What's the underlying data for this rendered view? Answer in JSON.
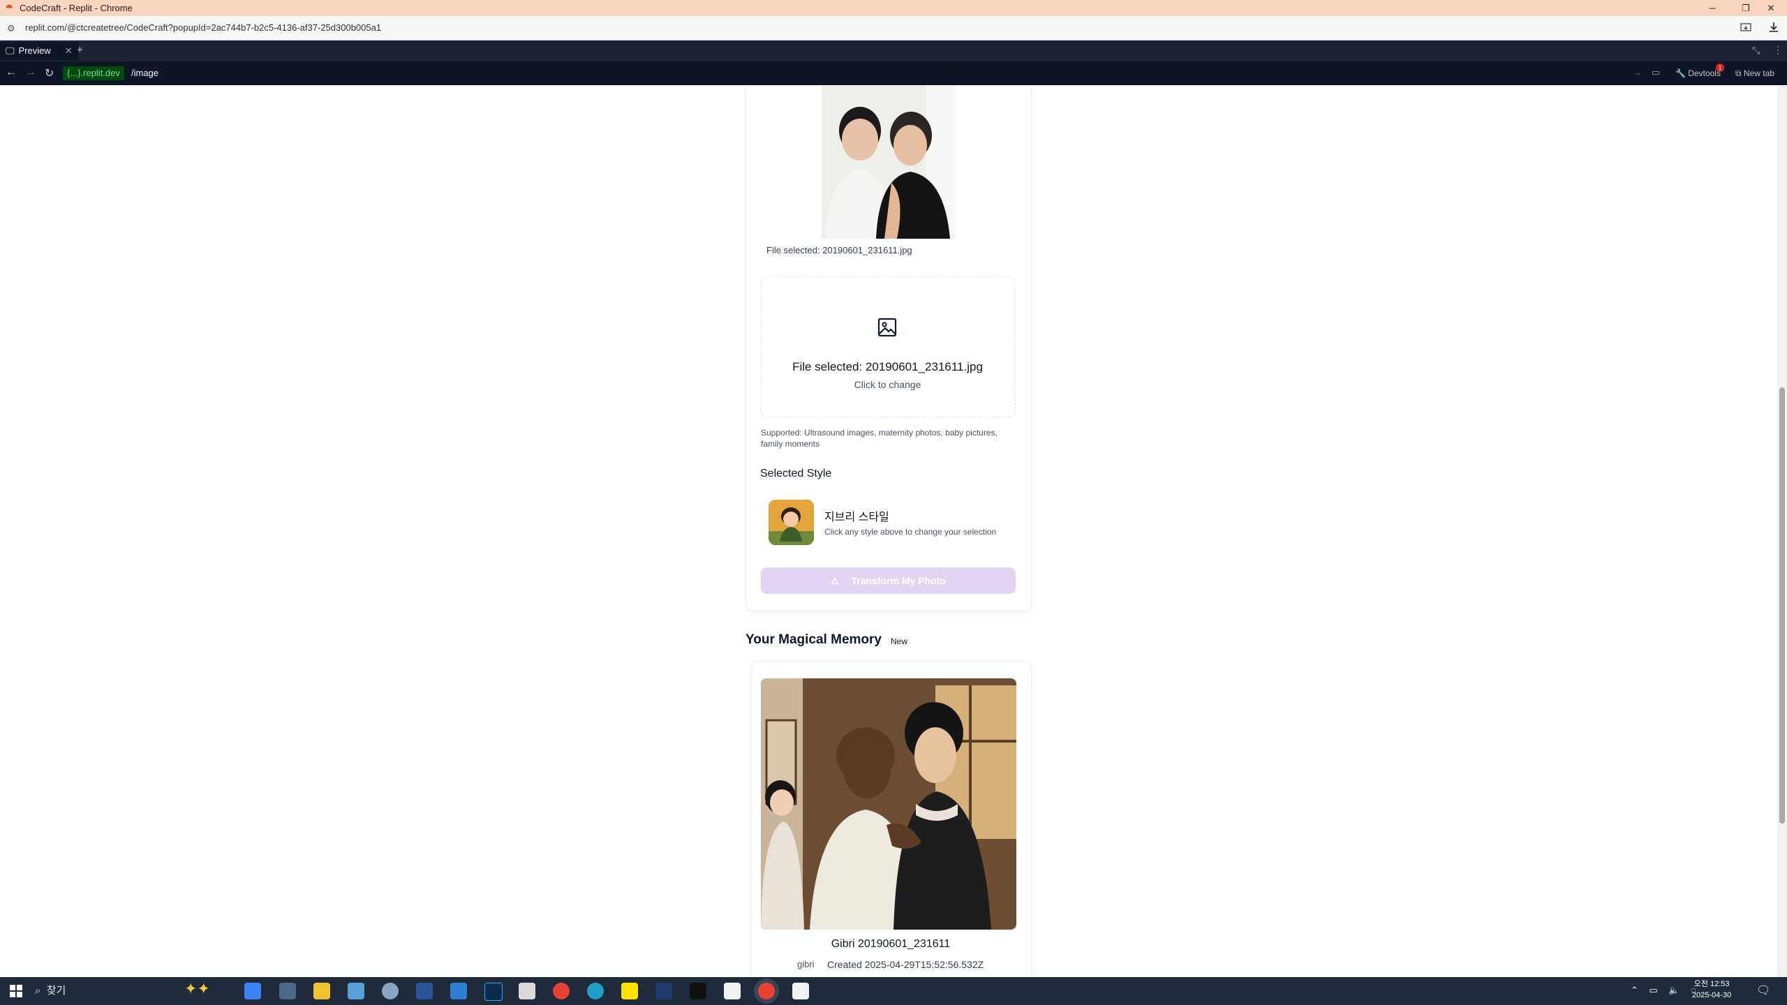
{
  "window": {
    "title": "CodeCraft - Replit - Chrome",
    "url": "replit.com/@ctcreatetree/CodeCraft?popupId=2ac744b7-b2c5-4136-af37-25d300b005a1",
    "controls": {
      "minimize": "─",
      "restore": "❐",
      "close": "✕"
    }
  },
  "replit": {
    "tab_label": "Preview",
    "tab_close": "✕",
    "new_tab_plus": "+",
    "domain": "{...}.replit.dev",
    "path": "/image",
    "devtools_label": "Devtools",
    "devtools_badge": "1",
    "new_tab_label": "New tab"
  },
  "upload": {
    "file_caption": "File selected: 20190601_231611.jpg",
    "drop_file_text": "File selected: 20190601_231611.jpg",
    "drop_change_text": "Click to change",
    "supported_text": "Supported: Ultrasound images, maternity photos, baby pictures, family moments"
  },
  "style": {
    "heading": "Selected Style",
    "name": "지브리 스타일",
    "hint": "Click any style above to change your selection"
  },
  "transform_button": "Transform My Photo",
  "memory": {
    "heading": "Your Magical Memory",
    "badge": "New",
    "title": "Gibri 20190601_231611",
    "tag": "gibri",
    "created": "Created 2025-04-29T15:52:56.532Z"
  },
  "taskbar": {
    "search_label": "찾기",
    "time": "오전 12:53",
    "date": "2025-04-30",
    "app_icons": [
      "copilot",
      "calculator",
      "file-explorer",
      "app-blue",
      "app-circle",
      "word",
      "app-store",
      "photoshop",
      "camera",
      "chrome",
      "edge",
      "kakaotalk",
      "terminal",
      "app-dark",
      "notion",
      "chrome-active",
      "notion-2"
    ]
  },
  "colors": {
    "accent_button": "#e2d5f2",
    "replit_bg": "#0e1525",
    "domain_chip_text": "#6fdc8c",
    "titlebar": "#f9d4bf"
  }
}
